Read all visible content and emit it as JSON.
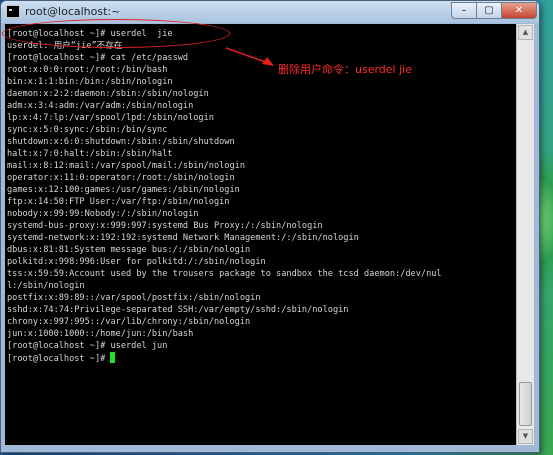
{
  "window": {
    "title": "root@localhost:~"
  },
  "controls": {
    "minimize": "–",
    "maximize": "▢",
    "close": "✕"
  },
  "terminal": {
    "lines": [
      "[root@localhost ~]# userdel  jie",
      "userdel: 用户“jie”不存在",
      "[root@localhost ~]# cat /etc/passwd",
      "root:x:0:0:root:/root:/bin/bash",
      "bin:x:1:1:bin:/bin:/sbin/nologin",
      "daemon:x:2:2:daemon:/sbin:/sbin/nologin",
      "adm:x:3:4:adm:/var/adm:/sbin/nologin",
      "lp:x:4:7:lp:/var/spool/lpd:/sbin/nologin",
      "sync:x:5:0:sync:/sbin:/bin/sync",
      "shutdown:x:6:0:shutdown:/sbin:/sbin/shutdown",
      "halt:x:7:0:halt:/sbin:/sbin/halt",
      "mail:x:8:12:mail:/var/spool/mail:/sbin/nologin",
      "operator:x:11:0:operator:/root:/sbin/nologin",
      "games:x:12:100:games:/usr/games:/sbin/nologin",
      "ftp:x:14:50:FTP User:/var/ftp:/sbin/nologin",
      "nobody:x:99:99:Nobody:/:/sbin/nologin",
      "systemd-bus-proxy:x:999:997:systemd Bus Proxy:/:/sbin/nologin",
      "systemd-network:x:192:192:systemd Network Management:/:/sbin/nologin",
      "dbus:x:81:81:System message bus:/:/sbin/nologin",
      "polkitd:x:998:996:User for polkitd:/:/sbin/nologin",
      "tss:x:59:59:Account used by the trousers package to sandbox the tcsd daemon:/dev/nul",
      "l:/sbin/nologin",
      "postfix:x:89:89::/var/spool/postfix:/sbin/nologin",
      "sshd:x:74:74:Privilege-separated SSH:/var/empty/sshd:/sbin/nologin",
      "chrony:x:997:995::/var/lib/chrony:/sbin/nologin",
      "jun:x:1000:1000::/home/jun:/bin/bash",
      "[root@localhost ~]# userdel jun",
      "[root@localhost ~]# "
    ]
  },
  "annotation": {
    "text": "删除用户命令：userdel jie",
    "color": "#ff2a2a"
  },
  "colors": {
    "terminal_bg": "#000000",
    "terminal_fg": "#d6d6d6",
    "cursor": "#23e023"
  }
}
